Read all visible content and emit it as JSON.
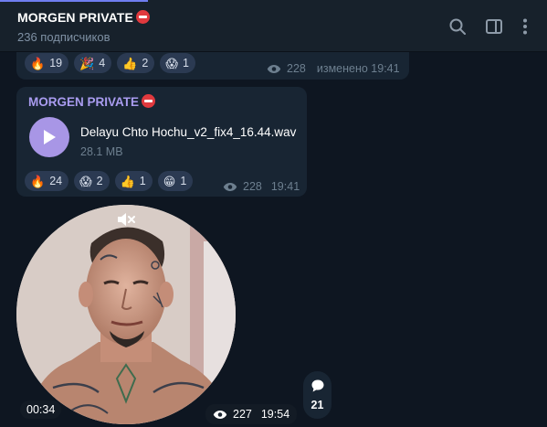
{
  "header": {
    "title": "MORGEN PRIVATE",
    "subscribers": "236 подписчиков",
    "icons": [
      "search-icon",
      "sidebar-toggle-icon",
      "more-icon"
    ]
  },
  "message1": {
    "reactions": [
      {
        "emoji": "🔥",
        "count": "19"
      },
      {
        "emoji": "🎉",
        "count": "4"
      },
      {
        "emoji": "👍",
        "count": "2"
      },
      {
        "emoji": "😱",
        "count": "1"
      }
    ],
    "views": "228",
    "edited_time": "изменено 19:41"
  },
  "message2": {
    "author": "MORGEN PRIVATE",
    "file_name": "Delayu Chto Hochu_v2_fix4_16.44.wav",
    "file_size": "28.1 MB",
    "reactions": [
      {
        "emoji": "🔥",
        "count": "24"
      },
      {
        "emoji": "😱",
        "count": "2"
      },
      {
        "emoji": "👍",
        "count": "1"
      },
      {
        "emoji": "😁",
        "count": "1"
      }
    ],
    "views": "228",
    "time": "19:41"
  },
  "video_message": {
    "duration": "00:34",
    "views": "227",
    "time": "19:54",
    "comments": "21"
  },
  "colors": {
    "background": "#0e1621",
    "header": "#17212b",
    "bubble": "#182533",
    "accent": "#a896e6",
    "author": "#a99cf0"
  }
}
